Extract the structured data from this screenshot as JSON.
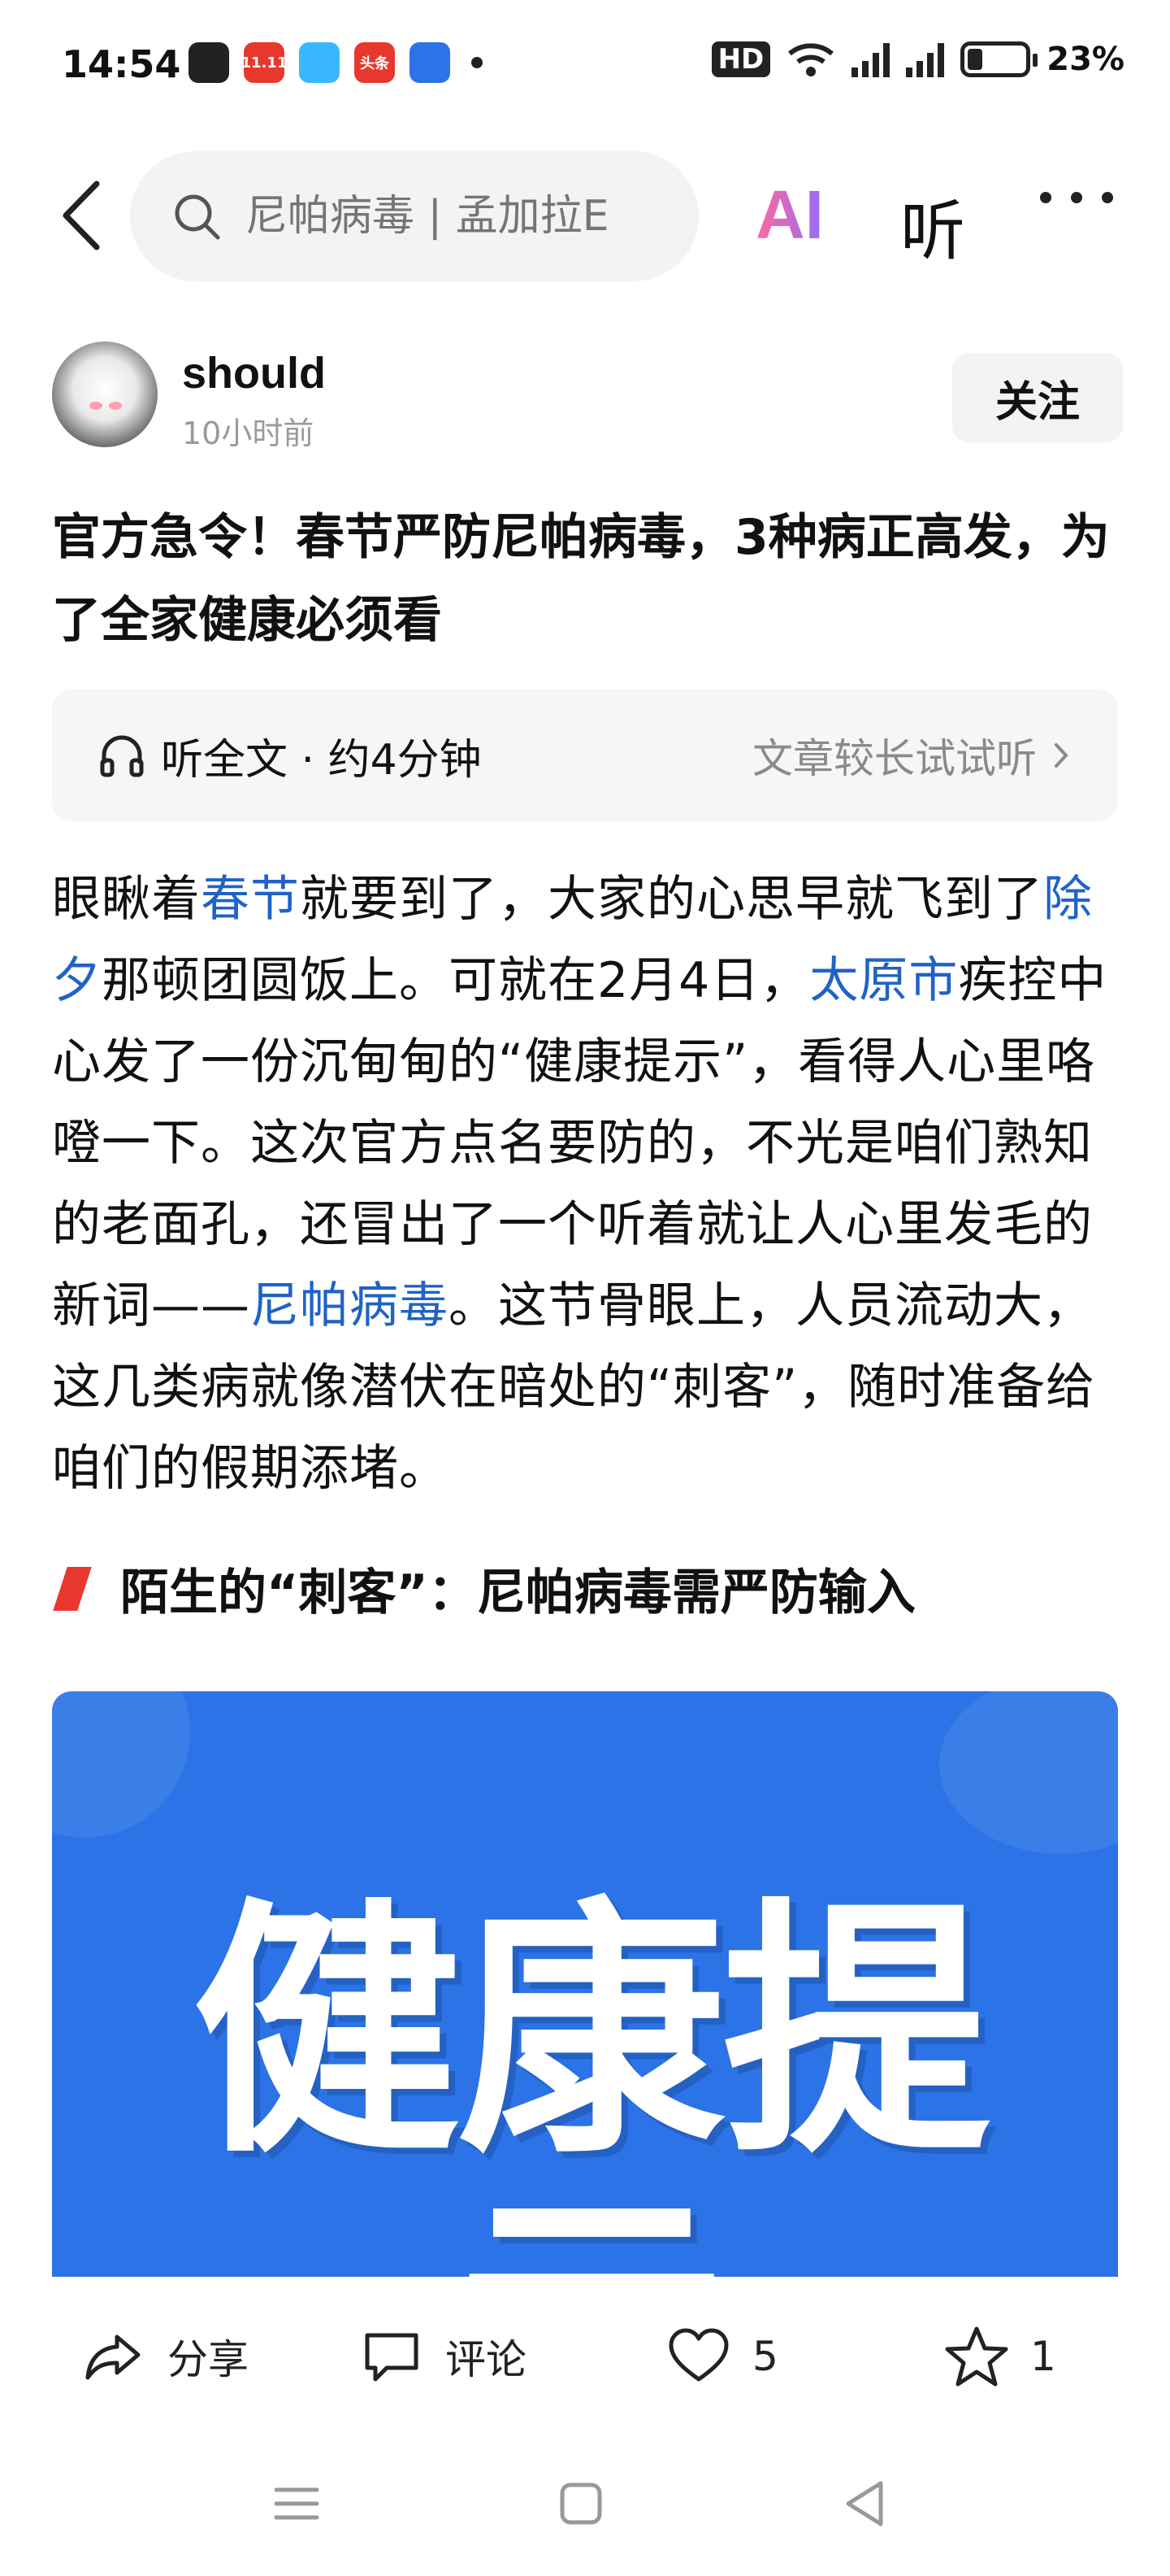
{
  "status_bar": {
    "time": "14:54",
    "app_icons": [
      {
        "name": "wechat-icon",
        "color": "#222222",
        "text": ""
      },
      {
        "name": "taobao-1111-icon",
        "color": "#e8382e",
        "text": "11.11"
      },
      {
        "name": "colorful-app-icon",
        "color": "#39b8ff",
        "text": ""
      },
      {
        "name": "toutiao-icon",
        "color": "#e8382e",
        "text": "头条"
      },
      {
        "name": "cloud-app-icon",
        "color": "#2b73e6",
        "text": ""
      }
    ],
    "hd_label": "HD",
    "battery": "23%"
  },
  "top_nav": {
    "search_placeholder": "尼帕病毒 | 孟加拉E",
    "ai_label": "AI",
    "listen_label": "听"
  },
  "author": {
    "name": "should",
    "time": "10小时前",
    "follow_label": "关注"
  },
  "article": {
    "title": "官方急令！春节严防尼帕病毒，3种病正高发，为了全家健康必须看",
    "listen_bar": {
      "label": "听全文 · 约4分钟",
      "hint": "文章较长试试听"
    },
    "paragraph_segments": [
      {
        "text": "眼瞅着",
        "link": false
      },
      {
        "text": "春节",
        "link": true
      },
      {
        "text": "就要到了，大家的心思早就飞到了",
        "link": false
      },
      {
        "text": "除夕",
        "link": true
      },
      {
        "text": "那顿团圆饭上。可就在2月4日，",
        "link": false
      },
      {
        "text": "太原市",
        "link": true
      },
      {
        "text": "疾控中心发了一份沉甸甸的“健康提示”，看得人心里咯噔一下。这次官方点名要防的，不光是咱们熟知的老面孔，还冒出了一个听着就让人心里发毛的新词——",
        "link": false
      },
      {
        "text": "尼帕病毒",
        "link": true
      },
      {
        "text": "。这节骨眼上，人员流动大，这几类病就像潜伏在暗处的“刺客”，随时准备给咱们的假期添堵。",
        "link": false
      }
    ],
    "subheading": "陌生的“刺客”：尼帕病毒需严防输入",
    "image_text": "健康提示",
    "image_color": "#2b73e6",
    "accent_red": "#e8382e",
    "link_color": "#1f63c6"
  },
  "action_bar": {
    "share_label": "分享",
    "comment_label": "评论",
    "like_count": "5",
    "favorite_count": "1"
  }
}
